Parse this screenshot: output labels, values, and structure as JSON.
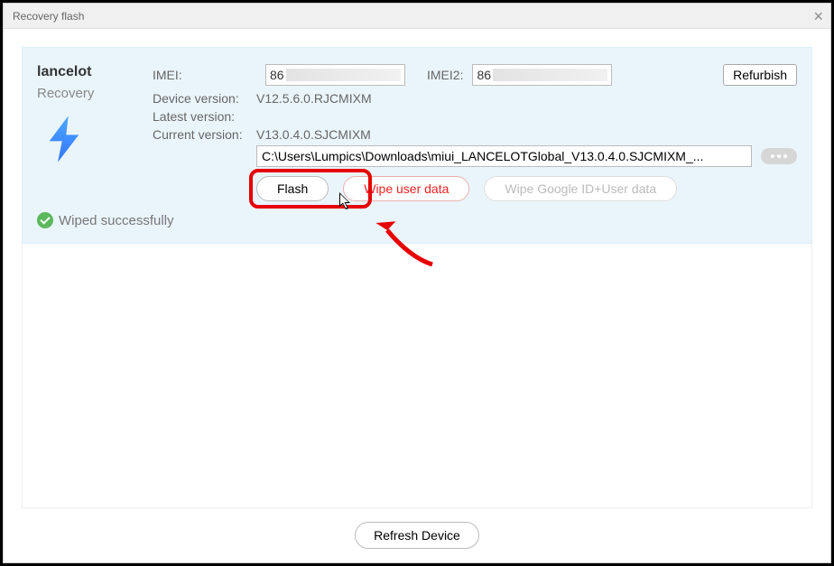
{
  "window": {
    "title": "Recovery flash"
  },
  "device": {
    "name": "lancelot",
    "mode": "Recovery"
  },
  "labels": {
    "imei": "IMEI:",
    "imei2": "IMEI2:",
    "device_version": "Device version:",
    "latest_version": "Latest version:",
    "current_version": "Current version:"
  },
  "imei": {
    "prefix1": "86",
    "prefix2": "86"
  },
  "buttons": {
    "refurbish": "Refurbish",
    "flash": "Flash",
    "wipe_user": "Wipe user data",
    "wipe_google": "Wipe Google ID+User data",
    "refresh": "Refresh Device"
  },
  "versions": {
    "device": "V12.5.6.0.RJCMIXM",
    "latest": "",
    "current": "V13.0.4.0.SJCMIXM"
  },
  "path": "C:\\Users\\Lumpics\\Downloads\\miui_LANCELOTGlobal_V13.0.4.0.SJCMIXM_...",
  "status": {
    "message": "Wiped successfully"
  }
}
